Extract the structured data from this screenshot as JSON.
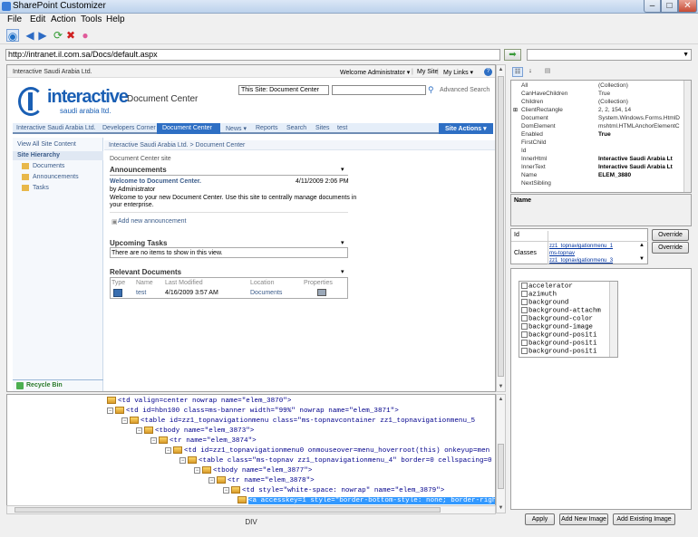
{
  "window": {
    "title": "SharePoint Customizer",
    "min": "–",
    "max": "□",
    "close": "✕"
  },
  "menu": [
    "File",
    "Edit",
    "Action",
    "Tools",
    "Help"
  ],
  "address": {
    "url": "http://intranet.il.com.sa/Docs/default.aspx"
  },
  "sp": {
    "site_name": "Interactive Saudi Arabia Ltd.",
    "welcome": "Welcome Administrator ▾",
    "mysite": "My Site",
    "mylinks": "My Links ▾",
    "logo_big": "interactive",
    "logo_small": "saudi arabia ltd.",
    "page_title": "Document Center",
    "search_scope": "This Site: Document Center",
    "advanced": "Advanced Search",
    "tabs": [
      "Interactive Saudi Arabia Ltd.",
      "Developers Corner",
      "Document Center",
      "News ▾",
      "Reports",
      "Search",
      "Sites",
      "test"
    ],
    "site_actions": "Site Actions ▾",
    "view_all": "View All Site Content",
    "hierarchy": "Site Hierarchy",
    "left_items": [
      "Documents",
      "Announcements",
      "Tasks"
    ],
    "recycle": "Recycle Bin",
    "breadcrumb": "Interactive Saudi Arabia Ltd. > Document Center",
    "subtitle": "Document Center site",
    "ann_header": "Announcements",
    "ann_title": "Welcome to Document Center.",
    "ann_date": "4/11/2009 2:06 PM",
    "ann_by": "by Administrator",
    "ann_body1": "Welcome to your new Document Center. Use this site to centrally manage documents in",
    "ann_body2": "your enterprise.",
    "add_ann": "Add new announcement",
    "tasks_header": "Upcoming Tasks",
    "tasks_empty": "There are no items to show in this view.",
    "docs_header": "Relevant Documents",
    "doc_cols": [
      "Type",
      "Name",
      "Last Modified",
      "Location",
      "Properties"
    ],
    "doc_row": {
      "name": "test",
      "modified": "4/16/2009 3:57 AM",
      "location": "Documents"
    }
  },
  "tree": [
    "<td valign=center nowrap name=\"elem_3870\">",
    "<td id=hbn100 class=ms-banner width=\"99%\" nowrap name=\"elem_3871\">",
    "<table id=zz1_topnavigationmenu class=\"ms-topnavcontainer zz1_topnavigationmenu_5",
    "<tbody name=\"elem_3873\">",
    "<tr name=\"elem_3874\">",
    "<td id=zz1_topnavigationmenu0 onmouseover=menu_hoverroot(this) onkeyup=men",
    "<table class=\"ms-topnav zz1_topnavigationmenu_4\" border=0 cellspacing=0 c",
    "<tbody name=\"elem_3877\">",
    "<tr name=\"elem_3878\">",
    "<td style=\"white-space: nowrap\" name=\"elem_3879\">",
    "<a accesskey=1 style=\"border-bottom-style: none; border-right-s"
  ],
  "status": "DIV",
  "props": [
    {
      "name": "All",
      "value": "(Collection)",
      "bold": false
    },
    {
      "name": "CanHaveChildren",
      "value": "True",
      "bold": false
    },
    {
      "name": "Children",
      "value": "(Collection)",
      "bold": false
    },
    {
      "name": "ClientRectangle",
      "value": "2, 2, 154, 14",
      "bold": false
    },
    {
      "name": "Document",
      "value": "System.Windows.Forms.HtmlDo",
      "bold": false
    },
    {
      "name": "DomElement",
      "value": "mshtml.HTMLAnchorElementClas",
      "bold": false
    },
    {
      "name": "Enabled",
      "value": "True",
      "bold": true
    },
    {
      "name": "FirstChild",
      "value": "",
      "bold": false
    },
    {
      "name": "Id",
      "value": "",
      "bold": false
    },
    {
      "name": "InnerHtml",
      "value": "Interactive Saudi Arabia Lt",
      "bold": true
    },
    {
      "name": "InnerText",
      "value": "Interactive Saudi Arabia Lt",
      "bold": true
    },
    {
      "name": "Name",
      "value": "ELEM_3880",
      "bold": true
    },
    {
      "name": "NextSibling",
      "value": "",
      "bold": false
    }
  ],
  "desc_label": "Name",
  "id_label": "Id",
  "classes_label": "Classes",
  "classes": [
    "zz1_topnavigationmenu_1",
    "ms-topnav",
    "zz1_topnavigationmenu_3"
  ],
  "override_label": "Override",
  "styles": [
    "accelerator",
    "azimuth",
    "background",
    "background-attachm",
    "background-color",
    "background-image",
    "background-positi",
    "background-positi",
    "background-positi"
  ],
  "buttons": {
    "apply": "Apply",
    "add_new": "Add New Image",
    "add_existing": "Add Existing Image"
  }
}
